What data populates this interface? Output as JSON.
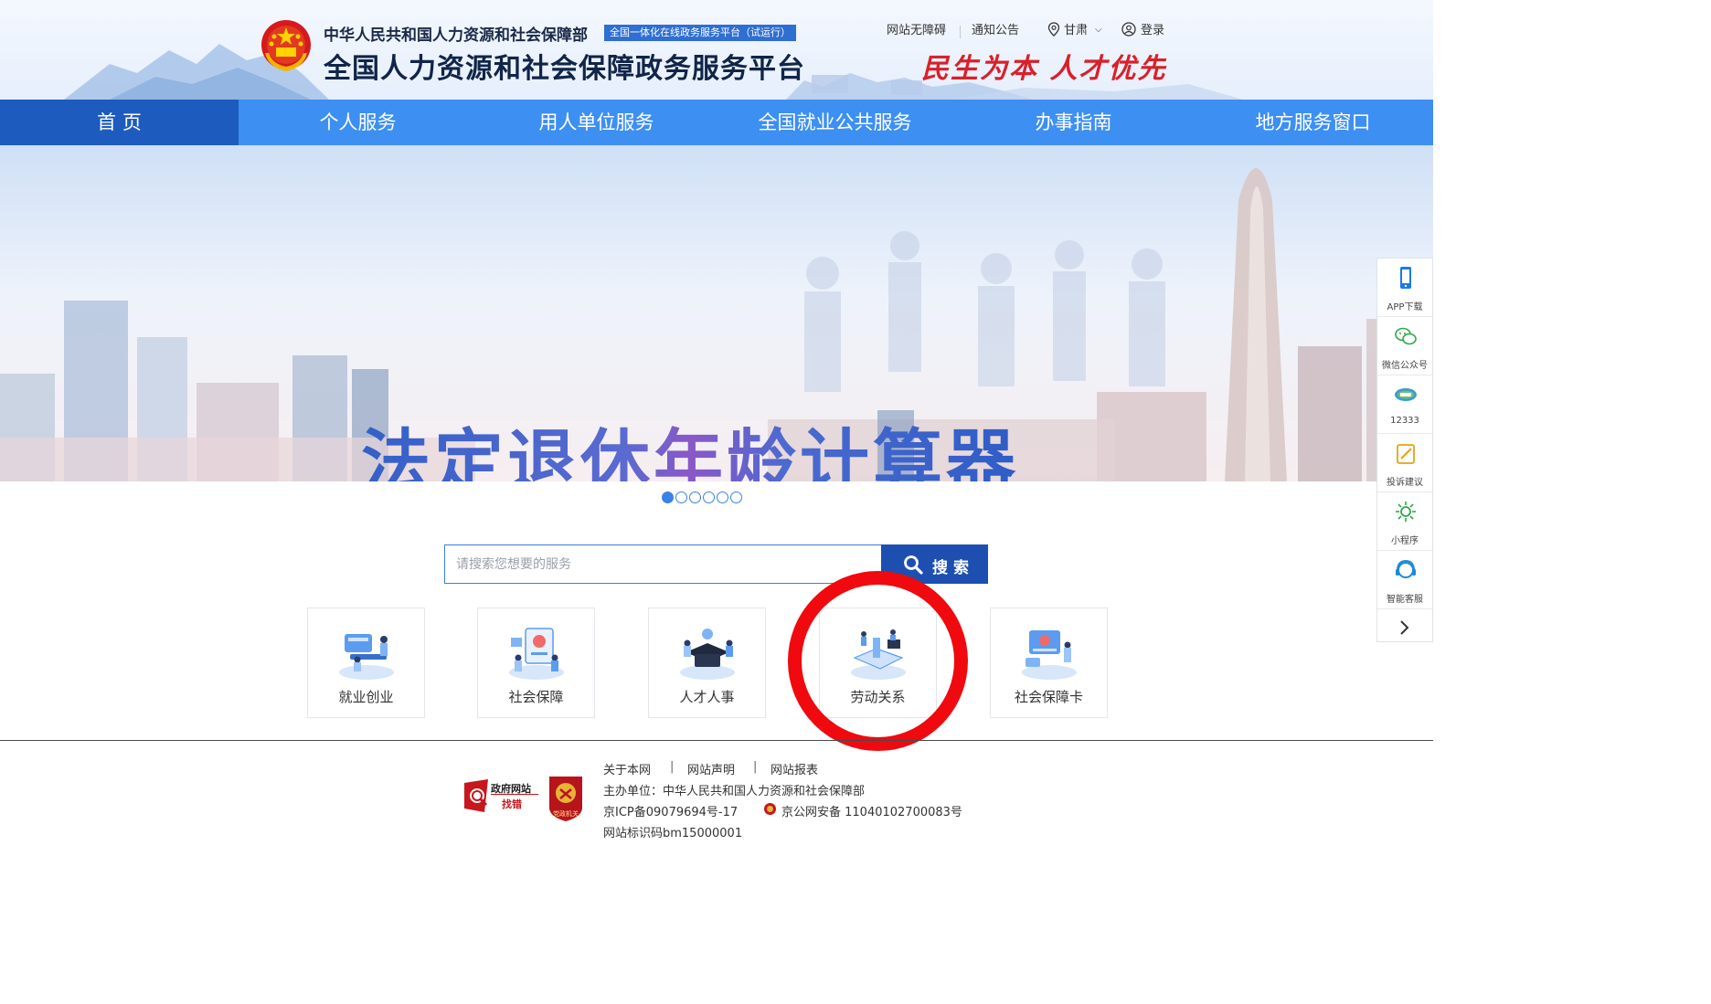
{
  "header": {
    "org_name": "中华人民共和国人力资源和社会保障部",
    "trial_badge": "全国一体化在线政务服务平台（试运行）",
    "platform_title": "全国人力资源和社会保障政务服务平台",
    "accessibility_link": "网站无障碍",
    "notice_link": "通知公告",
    "region": "甘肃",
    "login": "登录",
    "slogan": "民生为本 人才优先"
  },
  "nav": {
    "items": [
      {
        "label": "首 页"
      },
      {
        "label": "个人服务"
      },
      {
        "label": "用人单位服务"
      },
      {
        "label": "全国就业公共服务"
      },
      {
        "label": "办事指南"
      },
      {
        "label": "地方服务窗口"
      }
    ]
  },
  "banner": {
    "title": "法定退休年龄计算器",
    "slide_count": 6,
    "active_slide": 1
  },
  "search": {
    "placeholder": "请搜索您想要的服务",
    "button_label": "搜索"
  },
  "services": [
    {
      "label": "就业创业"
    },
    {
      "label": "社会保障"
    },
    {
      "label": "人才人事"
    },
    {
      "label": "劳动关系"
    },
    {
      "label": "社会保障卡"
    }
  ],
  "side_toolbar": {
    "items": [
      {
        "label": "APP下载",
        "icon": "phone-icon"
      },
      {
        "label": "微信公众号",
        "icon": "wechat-icon"
      },
      {
        "label": "12333",
        "icon": "hotline-12333-icon"
      },
      {
        "label": "投诉建议",
        "icon": "feedback-icon"
      },
      {
        "label": "小程序",
        "icon": "mini-program-icon"
      },
      {
        "label": "智能客服",
        "icon": "customer-service-icon"
      }
    ]
  },
  "footer": {
    "gov_find_title": "政府网站",
    "gov_find_sub": "找错",
    "party_badge_text": "党政机关",
    "links": [
      "关于本网",
      "网站声明",
      "网站报表"
    ],
    "separator": "|",
    "sponsor": "主办单位：中华人民共和国人力资源和社会保障部",
    "icp": "京ICP备09079694号-17",
    "police": "京公网安备 11040102700083号",
    "site_id": "网站标识码bm15000001"
  },
  "colors": {
    "nav_bg": "#3d8ff2",
    "nav_active": "#1d5bbf",
    "search_button": "#1d4fb0",
    "slogan": "#d9202a",
    "highlight_ring": "#f0090f"
  }
}
